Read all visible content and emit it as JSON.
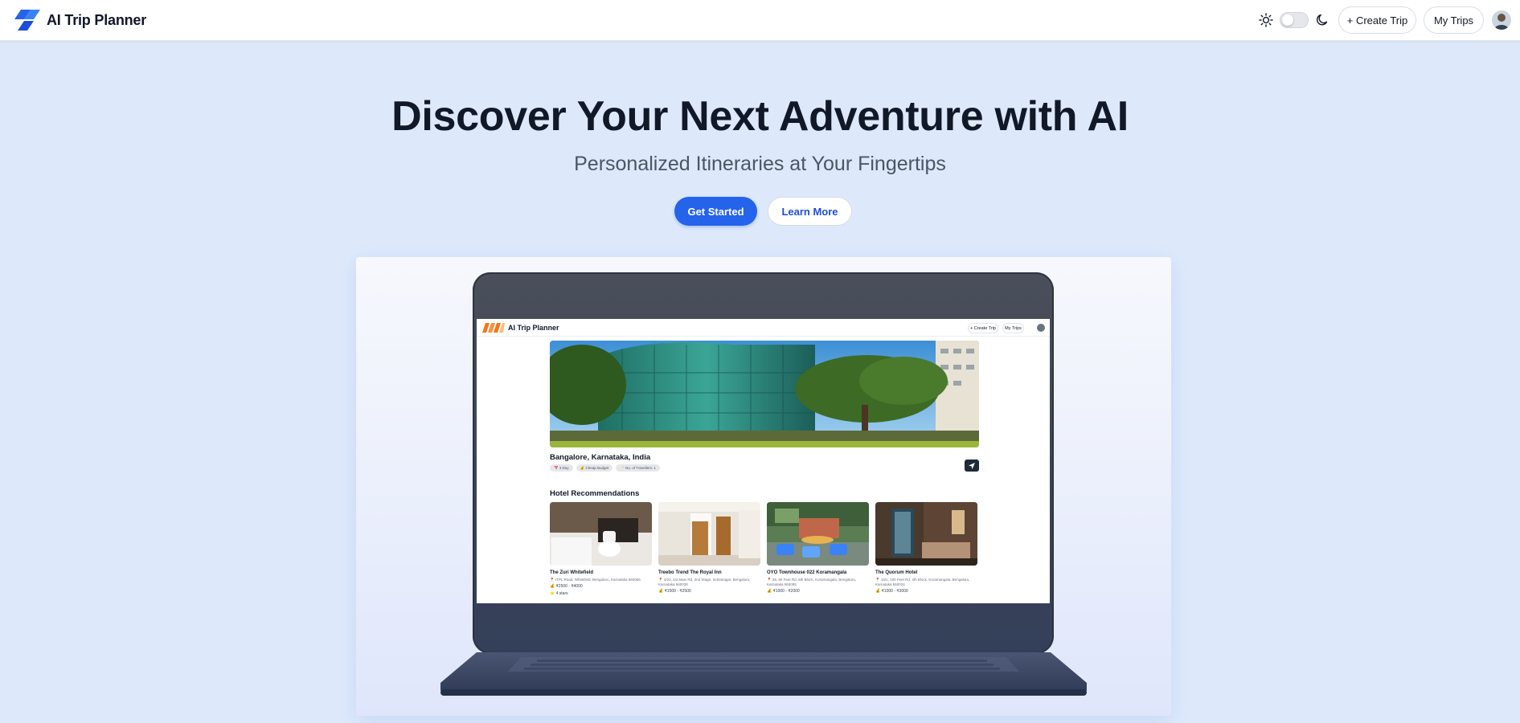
{
  "navbar": {
    "brand": "AI Trip Planner",
    "create_trip": "+ Create Trip",
    "my_trips": "My Trips",
    "theme_icons": [
      "sun-icon",
      "moon-icon"
    ],
    "theme_dark": false
  },
  "hero": {
    "title": "Discover Your Next Adventure with AI",
    "subtitle": "Personalized Itineraries at Your Fingertips",
    "primary_cta": "Get Started",
    "secondary_cta": "Learn More"
  },
  "preview": {
    "brand": "AI Trip Planner",
    "create_trip": "+ Create Trip",
    "my_trips": "My Trips",
    "place": "Bangalore, Karnataka, India",
    "chips": [
      "📅 3 Day",
      "💰 Cheap Budget",
      "🥂 No. of Travellers: 1"
    ],
    "section_title": "Hotel Recommendations",
    "hotels": [
      {
        "name": "The Zuri Whitefield",
        "address": "📍 ITPL Road, Whitefield, Bengaluru, Karnataka 560066",
        "price": "💰 ₹2500 - ₹4000",
        "rating": "⭐ 4 stars"
      },
      {
        "name": "Treebo Trend The Royal Inn",
        "address": "📍 4/23, 1st Main Rd, 2nd Stage, Indiranagar, Bengaluru, Karnataka 560038",
        "price": "💰 ₹1500 - ₹2500",
        "rating": ""
      },
      {
        "name": "OYO Townhouse 022 Koramangala",
        "address": "📍 28, 80 Feet Rd, 5th Block, Koramangala, Bengaluru, Karnataka 560095",
        "price": "💰 ₹1000 - ₹2000",
        "rating": ""
      },
      {
        "name": "The Quorum Hotel",
        "address": "📍 15/1, 100 Feet Rd, 4th Block, Koramangala, Bengaluru, Karnataka 560034",
        "price": "💰 ₹1000 - ₹3000",
        "rating": ""
      }
    ]
  },
  "colors": {
    "accent": "#2563eb",
    "page_bg": "#dde9fb",
    "title": "#111827"
  }
}
